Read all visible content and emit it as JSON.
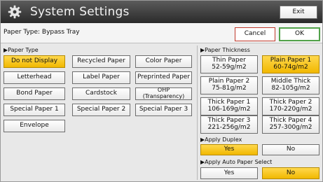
{
  "window": {
    "title": "System Settings",
    "exit_label": "Exit"
  },
  "toolbar": {
    "paper_type_label": "Paper Type: Bypass Tray",
    "cancel_label": "Cancel",
    "ok_label": "OK"
  },
  "paper_type": {
    "heading": "▶Paper Type",
    "options": [
      {
        "label": "Do not Display",
        "selected": true
      },
      {
        "label": "Recycled Paper",
        "selected": false
      },
      {
        "label": "Color Paper",
        "selected": false
      },
      {
        "label": "Letterhead",
        "selected": false
      },
      {
        "label": "Label Paper",
        "selected": false
      },
      {
        "label": "Preprinted Paper",
        "selected": false
      },
      {
        "label": "Bond Paper",
        "selected": false
      },
      {
        "label": "Cardstock",
        "selected": false
      },
      {
        "label": "OHP (Transparency)",
        "selected": false
      },
      {
        "label": "Special Paper 1",
        "selected": false
      },
      {
        "label": "Special Paper 2",
        "selected": false
      },
      {
        "label": "Special Paper 3",
        "selected": false
      },
      {
        "label": "Envelope",
        "selected": false
      }
    ]
  },
  "paper_thickness": {
    "heading": "▶Paper Thickness",
    "options": [
      {
        "line1": "Thin Paper",
        "line2": "52-59g/m2",
        "selected": false
      },
      {
        "line1": "Plain Paper 1",
        "line2": "60-74g/m2",
        "selected": true
      },
      {
        "line1": "Plain Paper 2",
        "line2": "75-81g/m2",
        "selected": false
      },
      {
        "line1": "Middle Thick",
        "line2": "82-105g/m2",
        "selected": false
      },
      {
        "line1": "Thick Paper 1",
        "line2": "106-169g/m2",
        "selected": false
      },
      {
        "line1": "Thick Paper 2",
        "line2": "170-220g/m2",
        "selected": false
      },
      {
        "line1": "Thick Paper 3",
        "line2": "221-256g/m2",
        "selected": false
      },
      {
        "line1": "Thick Paper 4",
        "line2": "257-300g/m2",
        "selected": false
      }
    ]
  },
  "apply_duplex": {
    "heading": "▶Apply Duplex",
    "yes_label": "Yes",
    "no_label": "No",
    "selected": "Yes"
  },
  "apply_auto_paper_select": {
    "heading": "▶Apply Auto Paper Select",
    "yes_label": "Yes",
    "no_label": "No",
    "selected": "No"
  },
  "colors": {
    "selected": "#f1b800",
    "title_bg": "#2a2a2a",
    "exit_green": "#6f9a48",
    "ok_border": "#52a24a",
    "cancel_border": "#c0392b"
  },
  "icons": {
    "title_icon": "gear-icon"
  }
}
